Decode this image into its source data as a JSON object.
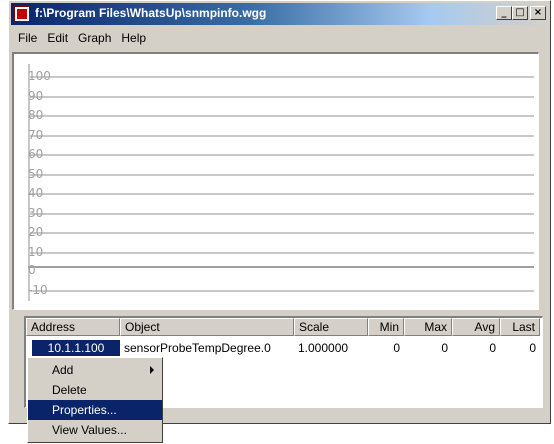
{
  "window": {
    "title": "f:\\Program Files\\WhatsUp\\snmpinfo.wgg",
    "caption_buttons": {
      "minimize": "_",
      "maximize": "□",
      "close": "×"
    }
  },
  "menubar": {
    "items": [
      "File",
      "Edit",
      "Graph",
      "Help"
    ]
  },
  "graph": {
    "y_labels": [
      "100",
      "90",
      "80",
      "70",
      "60",
      "50",
      "40",
      "30",
      "20",
      "10",
      "0",
      "-10"
    ]
  },
  "list": {
    "columns": [
      "Address",
      "Object",
      "Scale",
      "Min",
      "Max",
      "Avg",
      "Last"
    ],
    "rows": [
      {
        "address": "10.1.1.100",
        "object": "sensorProbeTempDegree.0",
        "scale": "1.000000",
        "min": "0",
        "max": "0",
        "avg": "0",
        "last": "0"
      }
    ]
  },
  "context_menu": {
    "items": [
      "Add",
      "Delete",
      "Properties...",
      "View Values..."
    ],
    "highlighted": "Properties..."
  },
  "colors": {
    "title_gradient_start": "#0a246a",
    "selection": "#0a246a",
    "face": "#d4d0c8"
  }
}
